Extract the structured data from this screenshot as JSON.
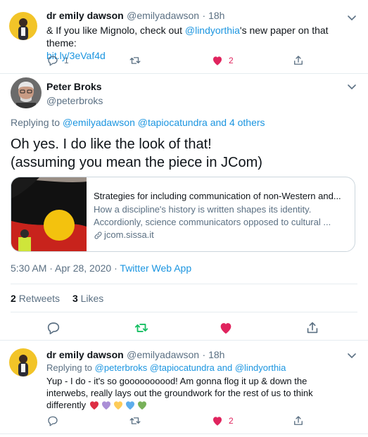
{
  "tweet1": {
    "name": "dr emily dawson",
    "handle": "@emilyadawson",
    "time": "· 18h",
    "text_prefix": "& If you like Mignolo, check out ",
    "mention": "@lindyorthia",
    "text_suffix": "'s new paper on that theme:",
    "link": "bit.ly/3eVaf4d",
    "reply_count": "1",
    "like_count": "2"
  },
  "main": {
    "name": "Peter Broks",
    "handle": "@peterbroks",
    "replying_prefix": "Replying to",
    "replying_mentions": "@emilyadawson @tapiocatundra and 4 others",
    "text_line1": "Oh yes. I do like the look of that!",
    "text_line2": "(assuming you mean the piece in JCom)",
    "card": {
      "title": "Strategies for including communication of non-Western and...",
      "description_line1": "How a discipline's history is written shapes its identity.",
      "description_line2": "Accordionly, science communicators opposed to cultural ...",
      "domain": "jcom.sissa.it"
    },
    "timestamp": "5:30 AM · Apr 28, 2020",
    "middot": "·",
    "source": "Twitter Web App",
    "retweets_count": "2",
    "retweets_label": "Retweets",
    "likes_count": "3",
    "likes_label": "Likes"
  },
  "tweet3": {
    "name": "dr emily dawson",
    "handle": "@emilyadawson",
    "time": "· 18h",
    "replying_prefix": "Replying to",
    "replying_mentions": "@peterbroks @tapiocatundra",
    "replying_and": "and",
    "replying_last": "@lindyorthia",
    "text_line1": "Yup - I do - it's so goooooooood! Am gonna flog it up & down the",
    "text_line2": "interwebs, really lays out the groundwork for the rest of us to think",
    "text_line3": "differently",
    "hearts": [
      "#dd2e44",
      "#aa8ed6",
      "#fdcb58",
      "#5dadec",
      "#78b159"
    ],
    "like_count": "2"
  },
  "colors": {
    "accent": "#1b95e0",
    "like": "#e0245e",
    "retweet": "#17bf63",
    "muted": "#5b7083"
  }
}
